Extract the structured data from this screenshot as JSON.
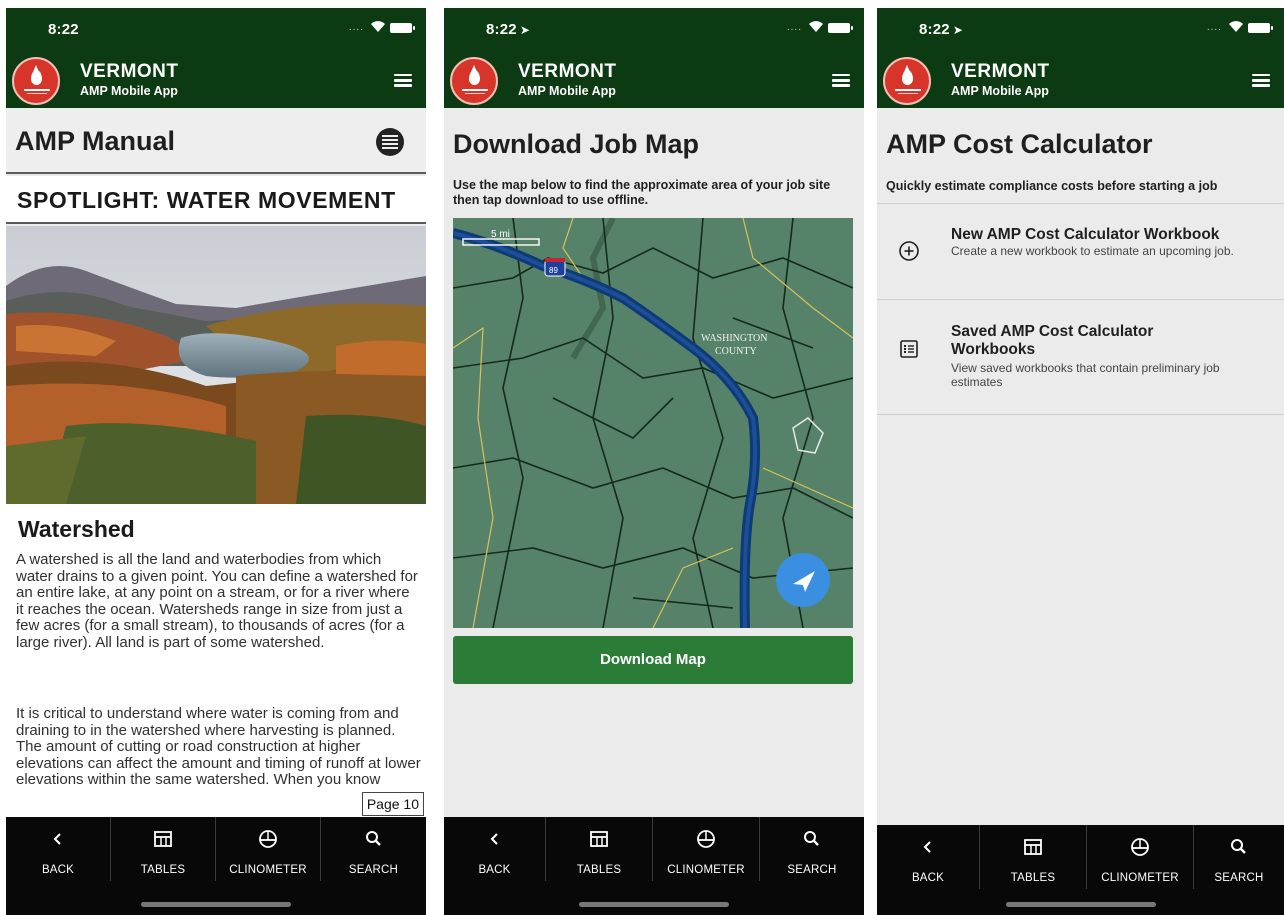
{
  "status": {
    "time": "8:22",
    "signal": "....",
    "location_arrow": "➤"
  },
  "app": {
    "title": "VERMONT",
    "subtitle": "AMP Mobile App"
  },
  "colors": {
    "header": "#0c3a12",
    "button": "#2b7c36",
    "accent_blue": "#3a8fe0",
    "tabbar": "#080808"
  },
  "manual": {
    "title": "AMP Manual",
    "spotlight": "SPOTLIGHT: WATER MOVEMENT",
    "article_title": "Watershed",
    "para1": "A watershed is all the land and waterbodies from which water drains to a given point. You can define a watershed for an entire lake, at any point on a stream, or for a river where it reaches the ocean. Watersheds range in size from just a few acres (for a small stream), to thousands of acres (for a large river). All land is part of some watershed.",
    "para2": "It is critical to understand where water is coming from and draining to in the watershed where harvesting is planned. The amount of cutting or road construction at higher elevations can affect the amount and timing of runoff at lower elevations within the same watershed. When you know",
    "page_badge": "Page 10"
  },
  "download": {
    "title": "Download Job Map",
    "subtitle": "Use the map below to find the approximate area of your job site then tap download to use offline.",
    "scale": "5 mi",
    "highway_shield": "89",
    "county_label_1": "WASHINGTON",
    "county_label_2": "COUNTY",
    "button": "Download Map"
  },
  "calculator": {
    "title": "AMP Cost Calculator",
    "subtitle": "Quickly estimate compliance costs before starting a job",
    "items": [
      {
        "icon": "plus-circle-icon",
        "title": "New AMP Cost Calculator Workbook",
        "desc": "Create a new workbook to estimate an upcoming job."
      },
      {
        "icon": "list-icon",
        "title": "Saved AMP Cost Calculator Workbooks",
        "desc": "View saved workbooks that contain preliminary job estimates"
      }
    ]
  },
  "tabs": [
    {
      "icon": "back-chevron-icon",
      "label": "BACK"
    },
    {
      "icon": "table-icon",
      "label": "TABLES"
    },
    {
      "icon": "clinometer-icon",
      "label": "CLINOMETER"
    },
    {
      "icon": "search-icon",
      "label": "SEARCH"
    }
  ]
}
